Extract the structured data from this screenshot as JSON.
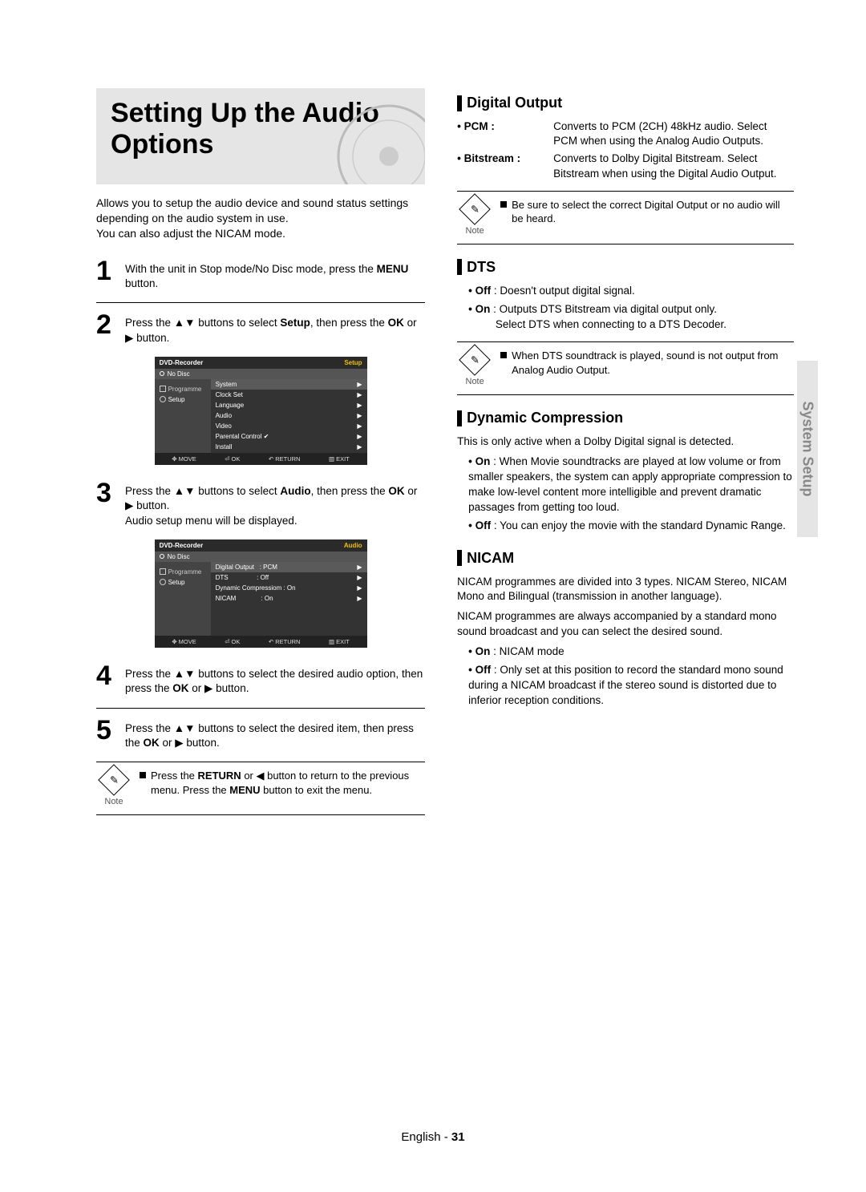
{
  "title": "Setting Up the Audio Options",
  "intro_lines": [
    "Allows you to setup the audio device and sound status settings depending on the audio system in use.",
    "You can also adjust the NICAM mode."
  ],
  "steps": {
    "s1": {
      "num": "1",
      "pre": "With the unit in Stop mode/No Disc mode, press the ",
      "bold": "MENU",
      "post": " button."
    },
    "s2": {
      "num": "2",
      "pre": "Press the ",
      "mid": " buttons to select ",
      "bold1": "Setup",
      "mid2": ", then press the ",
      "bold2": "OK",
      "post": " or ▶ button."
    },
    "s3": {
      "num": "3",
      "pre": "Press the ",
      "mid": " buttons to select ",
      "bold1": "Audio",
      "mid2": ", then press the  ",
      "bold2": "OK",
      "post": " or ▶ button.",
      "line2": "Audio setup menu will be displayed."
    },
    "s4": {
      "num": "4",
      "pre": "Press the ",
      "mid": " buttons to select the desired audio option, then press the ",
      "bold": "OK",
      "post": " or ▶ button."
    },
    "s5": {
      "num": "5",
      "pre": "Press the ",
      "mid": " buttons to select the desired item, then press the ",
      "bold": "OK",
      "post": " or ▶ button."
    }
  },
  "left_note": {
    "pre": "Press the ",
    "b1": "RETURN",
    "mid": " or ◀ button to return to the previous menu. Press the ",
    "b2": "MENU",
    "post": " button to exit the menu."
  },
  "osd1": {
    "title_left": "DVD-Recorder",
    "title_right": "Setup",
    "status": "No Disc",
    "left_items": [
      "Programme",
      "Setup"
    ],
    "rows": [
      {
        "label": "System",
        "hl": true
      },
      {
        "label": "Clock Set"
      },
      {
        "label": "Language"
      },
      {
        "label": "Audio"
      },
      {
        "label": "Video"
      },
      {
        "label": "Parental Control ✔"
      },
      {
        "label": "Install"
      }
    ],
    "footer": {
      "move": "MOVE",
      "ok": "OK",
      "ret": "RETURN",
      "exit": "EXIT"
    }
  },
  "osd2": {
    "title_left": "DVD-Recorder",
    "title_right": "Audio",
    "status": "No Disc",
    "left_items": [
      "Programme",
      "Setup"
    ],
    "rows": [
      {
        "label": "Digital Output",
        "value": ": PCM",
        "hl": true
      },
      {
        "label": "DTS",
        "value": ": Off"
      },
      {
        "label": "Dynamic Compressiom",
        "value": ": On"
      },
      {
        "label": "NICAM",
        "value": ": On"
      }
    ],
    "footer": {
      "move": "MOVE",
      "ok": "OK",
      "ret": "RETURN",
      "exit": "EXIT"
    }
  },
  "right": {
    "digital_output": {
      "title": "Digital Output",
      "pcm_label": "• PCM :",
      "pcm_body": "Converts to PCM (2CH) 48kHz audio. Select PCM when using the Analog Audio Outputs.",
      "bitstream_label": "• Bitstream :",
      "bitstream_body": "Converts to Dolby Digital Bitstream. Select Bitstream when using the Digital Audio Output.",
      "note": "Be sure to select the correct Digital Output or no audio will be heard."
    },
    "dts": {
      "title": "DTS",
      "off": "• Off : Doesn't output digital signal.",
      "on_l1": "• On : Outputs DTS Bitstream via digital output only.",
      "on_l2": "Select DTS when connecting to a DTS Decoder.",
      "note": "When DTS soundtrack is played, sound is not output from Analog Audio Output."
    },
    "dyn": {
      "title": "Dynamic Compression",
      "intro": "This is only active when a Dolby Digital signal is detected.",
      "on": "• On : When Movie soundtracks are played at low volume or from smaller speakers, the system can apply appropriate compression to make low-level content more intelligible and prevent dramatic passages from getting too loud.",
      "off": "• Off : You can enjoy the movie with the standard Dynamic Range."
    },
    "nicam": {
      "title": "NICAM",
      "p1": "NICAM programmes are divided into 3 types. NICAM Stereo, NICAM Mono and Bilingual (transmission in another language).",
      "p2": "NICAM programmes are always accompanied by a standard mono sound broadcast and you can select the desired sound.",
      "on": "• On : NICAM mode",
      "off": "• Off : Only set at this position to record the standard mono sound during a NICAM broadcast if the stereo sound is distorted due to inferior reception conditions."
    }
  },
  "side_tab": "System Setup",
  "note_label": "Note",
  "footer": {
    "lang": "English",
    "sep": " - ",
    "page": "31"
  }
}
